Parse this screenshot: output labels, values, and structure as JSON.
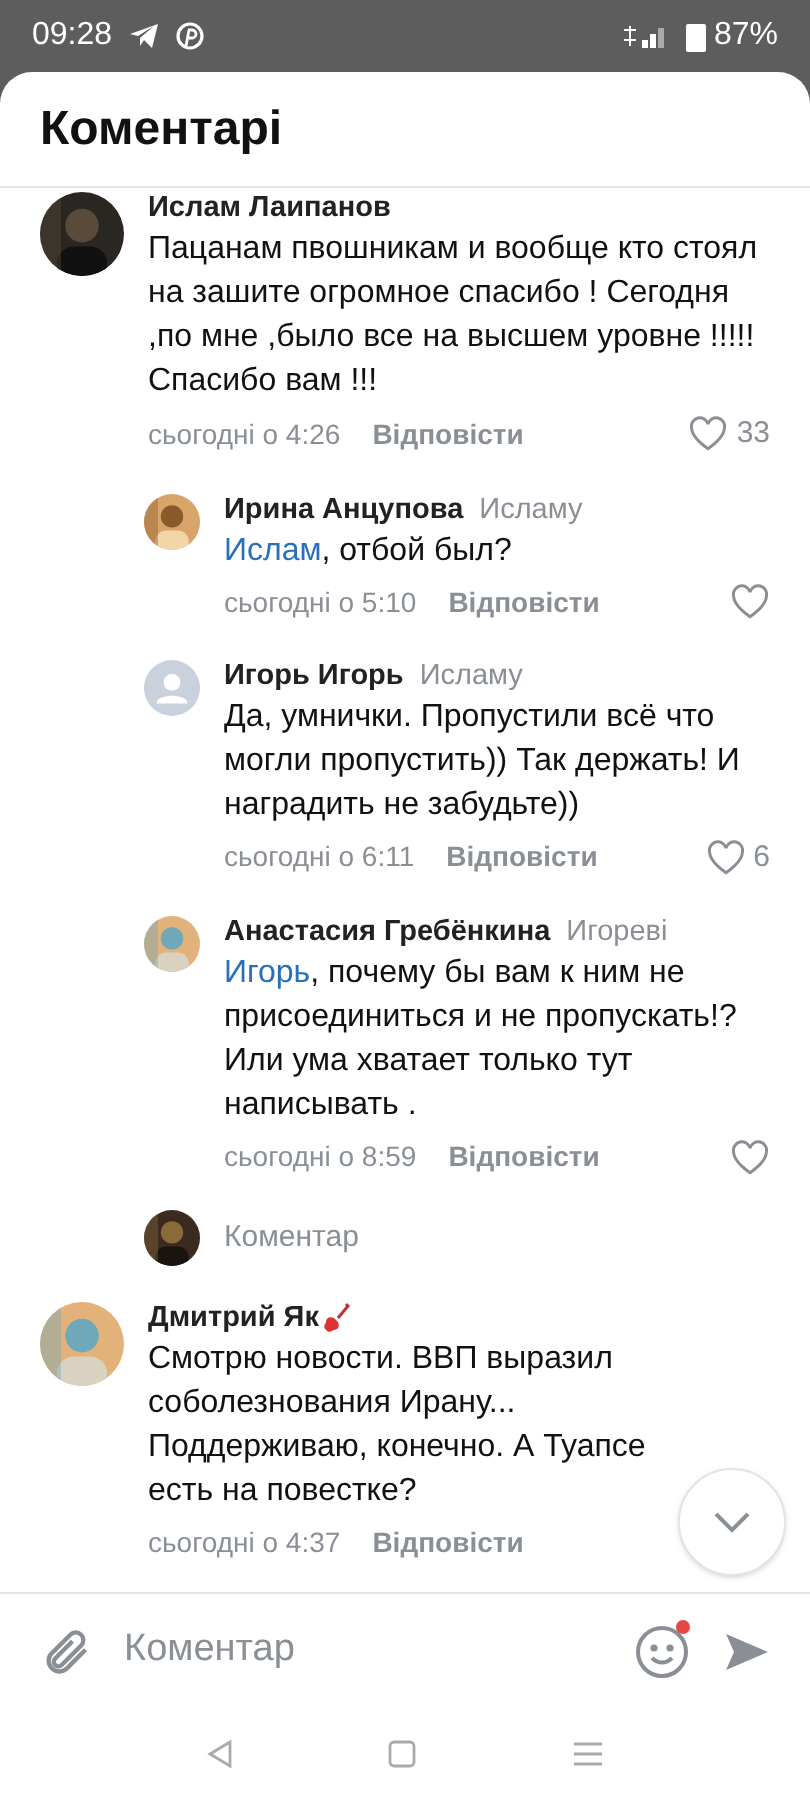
{
  "status_bar": {
    "time": "09:28",
    "battery": "87%"
  },
  "header": {
    "title": "Коментарі"
  },
  "comments": [
    {
      "author": "Ислам Лаипанов",
      "text": "Пацанам пвошникам и вообще кто стоял на зашите огромное спасибо ! Сегодня ,по мне ,было все на высшем уровне !!!!!  Спасибо вам !!!",
      "time": "сьогодні о 4:26",
      "reply": "Відповісти",
      "likes": "33",
      "replies": [
        {
          "author": "Ирина Анцупова",
          "to": "Исламу",
          "mention": "Ислам",
          "text": ", отбой был?",
          "time": "сьогодні о 5:10",
          "reply": "Відповісти"
        },
        {
          "author": "Игорь Игорь",
          "to": "Исламу",
          "text": "Да, умнички. Пропустили всё что могли пропустить)) Так держать! И наградить не забудьте))",
          "time": "сьогодні о 6:11",
          "reply": "Відповісти",
          "likes": "6",
          "avatar": {
            "kind": "default"
          }
        },
        {
          "author": "Анастасия Гребёнкина",
          "to": "Игореві",
          "mention": "Игорь",
          "text": ", почему бы вам к ним не присоединиться и не пропускать!? Или ума хватает только тут написывать .",
          "time": "сьогодні о 8:59",
          "reply": "Відповісти"
        }
      ],
      "reply_box": {
        "placeholder": "Коментар"
      }
    },
    {
      "author": "Дмитрий Як",
      "badge": true,
      "text": "Смотрю новости. ВВП выразил соболезнования Ирану... Поддерживаю, конечно. А Туапсе есть на повестке?",
      "time": "сьогодні о 4:37",
      "reply": "Відповісти"
    }
  ],
  "composer": {
    "placeholder": "Коментар",
    "emoji_notification": true
  }
}
